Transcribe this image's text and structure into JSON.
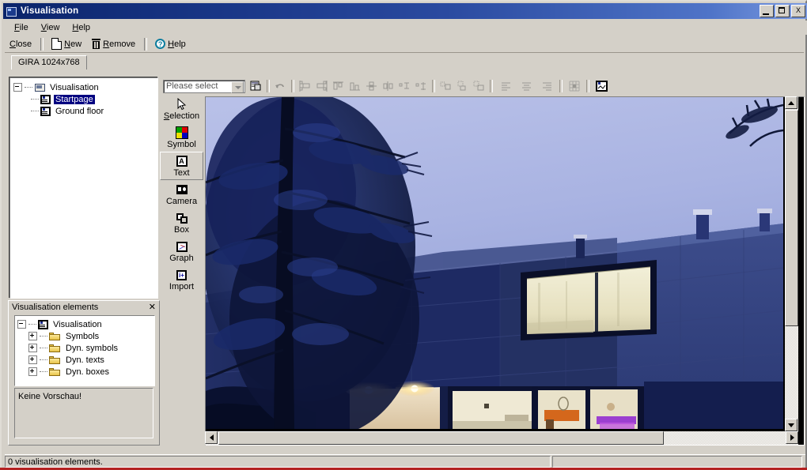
{
  "window": {
    "title": "Visualisation",
    "icon": "visualisation-window-icon",
    "buttons": {
      "minimize": "_",
      "maximize": "□",
      "close": "X"
    }
  },
  "menubar": [
    {
      "label": "File",
      "accel": "F"
    },
    {
      "label": "View",
      "accel": "V"
    },
    {
      "label": "Help",
      "accel": "H"
    }
  ],
  "toolbar": {
    "close_label": "Close",
    "new_label": "New",
    "remove_label": "Remove",
    "help_label": "Help",
    "new_icon": "new-document-icon",
    "remove_icon": "trash-icon",
    "help_icon": "help-circle-icon"
  },
  "tabs": [
    {
      "label": "GIRA 1024x768",
      "active": true
    }
  ],
  "project_tree": {
    "root": {
      "label": "Visualisation",
      "icon": "visualisation-icon",
      "expanded": true
    },
    "children": [
      {
        "label": "Startpage",
        "icon": "page-icon",
        "selected": true
      },
      {
        "label": "Ground floor",
        "icon": "page-icon",
        "selected": false
      }
    ]
  },
  "canvas_toolbar": {
    "select_combo": {
      "value": "Please select",
      "placeholder": "Please select"
    },
    "buttons": [
      {
        "name": "properties-button",
        "icon": "properties-icon",
        "enabled": true
      },
      {
        "name": "undo-button",
        "icon": "undo-arrow-icon",
        "enabled": false
      },
      {
        "name": "align-left-button",
        "icon": "align-objects-left-icon",
        "enabled": false
      },
      {
        "name": "align-right-button",
        "icon": "align-objects-right-icon",
        "enabled": false
      },
      {
        "name": "align-top-button",
        "icon": "align-objects-top-icon",
        "enabled": false
      },
      {
        "name": "align-bottom-button",
        "icon": "align-objects-bottom-icon",
        "enabled": false
      },
      {
        "name": "center-horizontal-button",
        "icon": "center-horizontal-icon",
        "enabled": false
      },
      {
        "name": "center-vertical-button",
        "icon": "center-vertical-icon",
        "enabled": false
      },
      {
        "name": "same-width-button",
        "icon": "same-width-icon",
        "enabled": false
      },
      {
        "name": "same-height-button",
        "icon": "same-height-icon",
        "enabled": false
      },
      {
        "name": "distribute-h-button",
        "icon": "distribute-horizontal-icon",
        "enabled": false
      },
      {
        "name": "distribute-v-button",
        "icon": "distribute-vertical-icon",
        "enabled": false
      },
      {
        "name": "distribute-grid-button",
        "icon": "distribute-grid-icon",
        "enabled": false
      },
      {
        "name": "text-align-left-button",
        "icon": "text-align-left-icon",
        "enabled": false
      },
      {
        "name": "text-align-center-button",
        "icon": "text-align-center-icon",
        "enabled": false
      },
      {
        "name": "text-align-right-button",
        "icon": "text-align-right-icon",
        "enabled": false
      },
      {
        "name": "grid-button",
        "icon": "grid-icon",
        "enabled": false
      },
      {
        "name": "page-preview-button",
        "icon": "page-icon",
        "enabled": true
      }
    ]
  },
  "tool_palette": [
    {
      "label": "Selection",
      "accel": "S",
      "icon": "cursor-arrow-icon",
      "active": false
    },
    {
      "label": "Symbol",
      "accel": "",
      "icon": "color-symbol-icon",
      "active": false
    },
    {
      "label": "Text",
      "accel": "",
      "icon": "text-a-icon",
      "active": true
    },
    {
      "label": "Camera",
      "accel": "",
      "icon": "camera-icon",
      "active": false
    },
    {
      "label": "Box",
      "accel": "",
      "icon": "box-icon",
      "active": false
    },
    {
      "label": "Graph",
      "accel": "",
      "icon": "graph-icon",
      "active": false
    },
    {
      "label": "Import",
      "accel": "",
      "icon": "import-icon",
      "active": false
    }
  ],
  "elements_panel": {
    "title": "Visualisation elements",
    "close_icon": "close-icon",
    "tree": {
      "root": {
        "label": "Visualisation",
        "icon": "visualisation-icon",
        "expanded": true
      },
      "children": [
        {
          "label": "Symbols",
          "icon": "folder-icon",
          "expanded": false
        },
        {
          "label": "Dyn. symbols",
          "icon": "folder-icon",
          "expanded": false
        },
        {
          "label": "Dyn. texts",
          "icon": "folder-icon",
          "expanded": false
        },
        {
          "label": "Dyn. boxes",
          "icon": "folder-icon",
          "expanded": false
        }
      ]
    },
    "preview_text": "Keine Vorschau!"
  },
  "statusbar": {
    "text": "0 visualisation elements."
  },
  "scrollbars": {
    "vertical": {
      "up_icon": "triangle-up-icon",
      "down_icon": "triangle-down-icon"
    },
    "horizontal": {
      "left_icon": "triangle-left-icon",
      "right_icon": "triangle-right-icon"
    }
  },
  "colors": {
    "title_start": "#0a246a",
    "title_end": "#7b9ae0",
    "face": "#d4d0c8",
    "selection": "#000080",
    "sky": "#aab4e0",
    "house": "#1f2d6b",
    "accent_red": "#b32222"
  }
}
